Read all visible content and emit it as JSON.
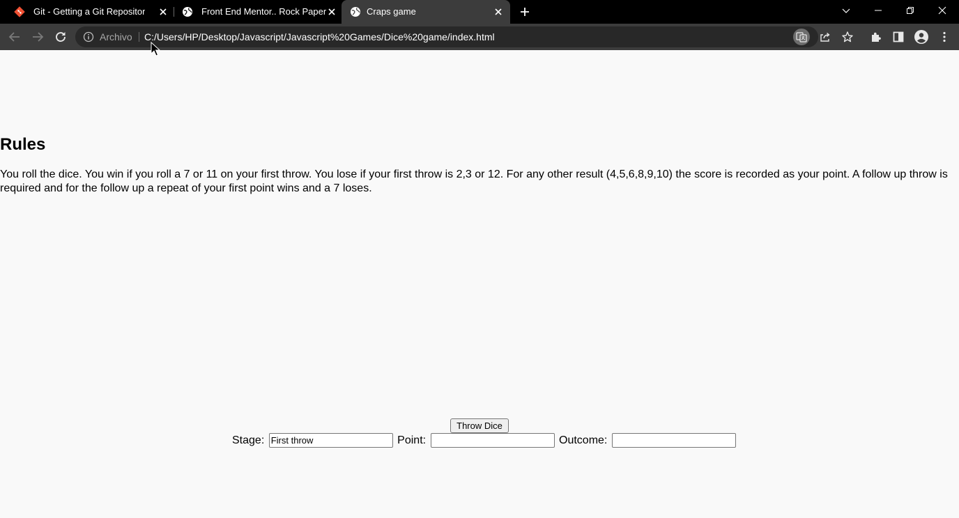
{
  "tabs": [
    {
      "title": "Git - Getting a Git Repository",
      "icon": "git-icon",
      "active": false
    },
    {
      "title": "Front End Mentor.. Rock Paper Sc",
      "icon": "globe-icon",
      "active": false
    },
    {
      "title": "Craps game",
      "icon": "globe-icon",
      "active": true
    }
  ],
  "toolbar": {
    "security_label": "Archivo",
    "url": "C:/Users/HP/Desktop/Javascript/Javascript%20Games/Dice%20game/index.html"
  },
  "page": {
    "heading": "Rules",
    "rules_text": "You roll the dice. You win if you roll a 7 or 11 on your first throw. You lose if your first throw is 2,3 or 12. For any other result (4,5,6,8,9,10) the score is recorded as your point. A follow up throw is required and for the follow up a repeat of your first point wins and a 7 loses.",
    "throw_button": "Throw Dice",
    "stage_label": "Stage:",
    "stage_value": "First throw",
    "point_label": "Point:",
    "point_value": "",
    "outcome_label": "Outcome:",
    "outcome_value": ""
  },
  "colors": {
    "tabbar_bg": "#000000",
    "toolbar_bg": "#3c3c3c",
    "omnibox_bg": "#282828",
    "page_bg": "#f9f9f9",
    "git_brand": "#f05033"
  }
}
